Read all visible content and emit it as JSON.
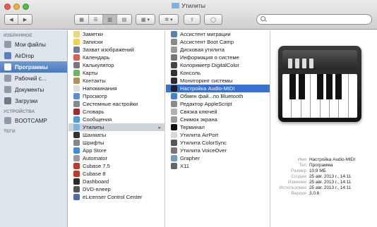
{
  "window": {
    "title": "Утилиты"
  },
  "toolbar": {
    "back_label": "◀",
    "forward_label": "▶",
    "view_icons": "▦",
    "view_list": "☰",
    "view_columns": "▥",
    "view_coverflow": "▤",
    "arrange_label": "▦ ▾",
    "action_label": "✲ ▾",
    "share_label": "⇪",
    "tag_label": "◯",
    "search_placeholder": ""
  },
  "sidebar": {
    "sections": [
      {
        "header": "ИЗБРАННОЕ",
        "items": [
          {
            "label": "Мои файлы",
            "icon": "all-files-icon",
            "color": "#8d9aa8"
          },
          {
            "label": "AirDrop",
            "icon": "airdrop-icon",
            "color": "#5b7fb8"
          },
          {
            "label": "Программы",
            "icon": "applications-icon",
            "color": "#ffffff",
            "selected": true
          },
          {
            "label": "Рабочий с...",
            "icon": "desktop-icon",
            "color": "#8d9aa8"
          },
          {
            "label": "Документы",
            "icon": "documents-icon",
            "color": "#8d9aa8"
          },
          {
            "label": "Загрузки",
            "icon": "downloads-icon",
            "color": "#6f7a86"
          }
        ]
      },
      {
        "header": "УСТРОЙСТВА",
        "items": [
          {
            "label": "BOOTCAMP",
            "icon": "disk-icon",
            "color": "#8d9aa8"
          }
        ]
      },
      {
        "header": "ТЕГИ",
        "items": []
      }
    ]
  },
  "column1": [
    {
      "label": "Заметки",
      "icon": "notes-icon",
      "color": "#e9d97a"
    },
    {
      "label": "Записки",
      "icon": "stickies-icon",
      "color": "#f2d24a"
    },
    {
      "label": "Захват изображений",
      "icon": "image-capture-icon",
      "color": "#6f7f99"
    },
    {
      "label": "Календарь",
      "icon": "calendar-icon",
      "color": "#e25b4b"
    },
    {
      "label": "Калькулятор",
      "icon": "calculator-icon",
      "color": "#777777"
    },
    {
      "label": "Карты",
      "icon": "maps-icon",
      "color": "#6bb55b"
    },
    {
      "label": "Контакты",
      "icon": "contacts-icon",
      "color": "#b58c5b"
    },
    {
      "label": "Напоминания",
      "icon": "reminders-icon",
      "color": "#dddddd"
    },
    {
      "label": "Просмотр",
      "icon": "preview-icon",
      "color": "#5b8ed1"
    },
    {
      "label": "Системные настройки",
      "icon": "system-preferences-icon",
      "color": "#8a8a8a"
    },
    {
      "label": "Словарь",
      "icon": "dictionary-icon",
      "color": "#9e2b2b"
    },
    {
      "label": "Сообщения",
      "icon": "messages-icon",
      "color": "#4a9ce0"
    },
    {
      "label": "Утилиты",
      "icon": "utilities-folder-icon",
      "color": "#7fb2de",
      "selected": true
    },
    {
      "label": "Шахматы",
      "icon": "chess-icon",
      "color": "#333333"
    },
    {
      "label": "Шрифты",
      "icon": "font-book-icon",
      "color": "#888888"
    },
    {
      "label": "App Store",
      "icon": "app-store-icon",
      "color": "#3d8fdc"
    },
    {
      "label": "Automator",
      "icon": "automator-icon",
      "color": "#9a9a9a"
    },
    {
      "label": "Cubase 7.5",
      "icon": "cubase-icon",
      "color": "#c0392b"
    },
    {
      "label": "Cubase 8",
      "icon": "cubase-icon",
      "color": "#c0392b"
    },
    {
      "label": "Dashboard",
      "icon": "dashboard-icon",
      "color": "#2b2b2b"
    },
    {
      "label": "DVD-плеер",
      "icon": "dvd-player-icon",
      "color": "#555555"
    },
    {
      "label": "eLicenser Control Center",
      "icon": "elicenser-icon",
      "color": "#4a6fa8"
    }
  ],
  "column2": [
    {
      "label": "Ассистент миграции",
      "icon": "migration-assistant-icon",
      "color": "#5a7fb0"
    },
    {
      "label": "Ассистент Boot Camp",
      "icon": "boot-camp-icon",
      "color": "#8a8a8a"
    },
    {
      "label": "Дисковая утилита",
      "icon": "disk-utility-icon",
      "color": "#9a9a9a"
    },
    {
      "label": "Информация о системе",
      "icon": "system-information-icon",
      "color": "#777777"
    },
    {
      "label": "Колориметр DigitalColor",
      "icon": "digitalcolor-icon",
      "color": "#444444"
    },
    {
      "label": "Консоль",
      "icon": "console-icon",
      "color": "#333333"
    },
    {
      "label": "Мониторинг системы",
      "icon": "activity-monitor-icon",
      "color": "#2b2b2b"
    },
    {
      "label": "Настройка Audio-MIDI",
      "icon": "audio-midi-icon",
      "color": "#222222",
      "highlighted": true
    },
    {
      "label": "Обмен фай...по Bluetooth",
      "icon": "bluetooth-icon",
      "color": "#4a7fd0"
    },
    {
      "label": "Редактор AppleScript",
      "icon": "applescript-icon",
      "color": "#8a8a8a"
    },
    {
      "label": "Связка ключей",
      "icon": "keychain-icon",
      "color": "#b0b0b0"
    },
    {
      "label": "Снимок экрана",
      "icon": "grab-icon",
      "color": "#9a9a9a"
    },
    {
      "label": "Терминал",
      "icon": "terminal-icon",
      "color": "#111111"
    },
    {
      "label": "Утилита AirPort",
      "icon": "airport-icon",
      "color": "#d8d8d8"
    },
    {
      "label": "Утилита ColorSync",
      "icon": "colorsync-icon",
      "color": "#555555"
    },
    {
      "label": "Утилита VoiceOver",
      "icon": "voiceover-icon",
      "color": "#777777"
    },
    {
      "label": "Grapher",
      "icon": "grapher-icon",
      "color": "#7a9ab8"
    },
    {
      "label": "X11",
      "icon": "x11-icon",
      "color": "#666666"
    }
  ],
  "preview": {
    "icon": "audio-midi-icon",
    "details": [
      {
        "key": "Имя",
        "value": "Настройка Audio-MIDI"
      },
      {
        "key": "Тип",
        "value": "Программа"
      },
      {
        "key": "Размер",
        "value": "10,9 МБ"
      },
      {
        "key": "Создан",
        "value": "25 авг. 2013 г., 14:11"
      },
      {
        "key": "Изменен",
        "value": "25 авг. 2013 г., 14:11"
      },
      {
        "key": "Использован",
        "value": "25 авг. 2013 г., 14:11"
      },
      {
        "key": "Версия",
        "value": "3.0.6"
      }
    ]
  }
}
